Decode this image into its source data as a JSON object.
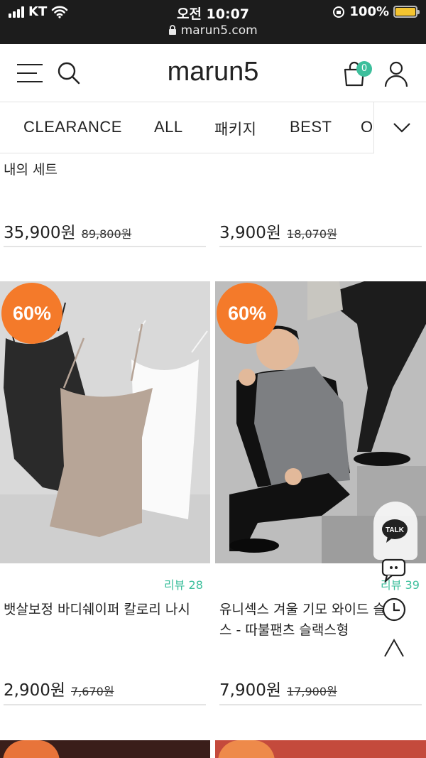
{
  "statusbar": {
    "carrier": "KT",
    "time": "오전 10:07",
    "url": "marun5.com",
    "battery": "100%"
  },
  "header": {
    "logo": "marun5",
    "cart_count": "0"
  },
  "category_nav": {
    "items": [
      "CLEARANCE",
      "ALL",
      "패키지",
      "BEST",
      "O"
    ]
  },
  "products": [
    {
      "title_line": "내의 세트",
      "price": "35,900원",
      "original_price": "89,800원"
    },
    {
      "price": "3,900원",
      "original_price": "18,070원"
    },
    {
      "badge": "60%",
      "review": "리뷰 28",
      "title": "뱃살보정 바디쉐이퍼 칼로리 나시",
      "price": "2,900원",
      "original_price": "7,670원"
    },
    {
      "badge": "60%",
      "review": "리뷰 39",
      "title_line1": "유니섹스 겨울 기모 와이드 슬랙",
      "title_line2": "스 - 따불팬츠 슬랙스형",
      "price": "7,900원",
      "original_price": "17,900원"
    }
  ],
  "floating": {
    "talk": "TALK"
  },
  "colors": {
    "accent_green": "#3dbf9c",
    "discount_orange": "#f47a2a",
    "statusbar_bg": "#1c1c1c"
  },
  "icons": [
    "signal-icon",
    "wifi-icon",
    "lock-icon",
    "battery-icon",
    "menu-icon",
    "search-icon",
    "cart-icon",
    "user-icon",
    "chevron-down-icon",
    "kakao-talk-icon",
    "chat-icon",
    "clock-icon",
    "scroll-top-icon"
  ]
}
